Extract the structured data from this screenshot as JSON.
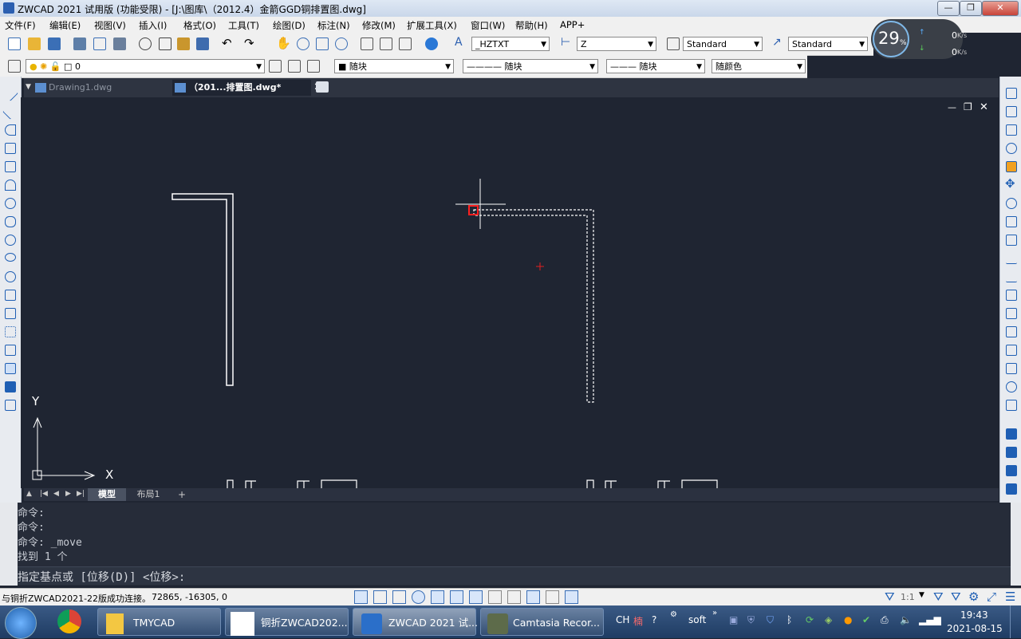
{
  "window": {
    "title": "ZWCAD 2021 试用版 (功能受限) - [J:\\图库\\（2012.4）金箭GGD铜排置图.dwg]",
    "min": "—",
    "max": "❐",
    "close": "✕"
  },
  "menu": [
    "文件(F)",
    "编辑(E)",
    "视图(V)",
    "插入(I)",
    "格式(O)",
    "工具(T)",
    "绘图(D)",
    "标注(N)",
    "修改(M)",
    "扩展工具(X)",
    "窗口(W)",
    "帮助(H)",
    "APP+"
  ],
  "toolbar1": {
    "text_style": "_HZTXT",
    "dim_style": "Z",
    "table_style": "Standard",
    "multileader_style": "Standard"
  },
  "toolbar2": {
    "layer": "0",
    "color": "随块",
    "linetype": "随块",
    "lineweight": "随块",
    "plotstyle": "随颜色"
  },
  "netmeter": {
    "percent": "29",
    "unit": "%",
    "up": "0",
    "down": "0",
    "rate_unit": "K/s"
  },
  "tabs": [
    {
      "label": "Drawing1.dwg",
      "active": false
    },
    {
      "label": "（201...排置图.dwg*",
      "active": true
    }
  ],
  "canvas_controls": {
    "min": "—",
    "restore": "❐",
    "close": "✕"
  },
  "ucs": {
    "x": "X",
    "y": "Y"
  },
  "layout_tabs": [
    "模型",
    "布局1",
    "+"
  ],
  "command": {
    "history": [
      "命令:",
      "命令:",
      "命令: _move",
      "找到 1 个"
    ],
    "prompt": "指定基点或 [位移(D)] <位移>:"
  },
  "status": {
    "message": "与铜折ZWCAD2021-22版成功连接。",
    "coords": "72865, -16305, 0",
    "scale": "1:1"
  },
  "taskbar": {
    "apps": [
      "TMYCAD",
      "铜折ZWCAD202...",
      "ZWCAD 2021 试...",
      "Camtasia Recor..."
    ],
    "lang": "CH",
    "soft": "soft",
    "time": "19:43",
    "date": "2021-08-15"
  }
}
